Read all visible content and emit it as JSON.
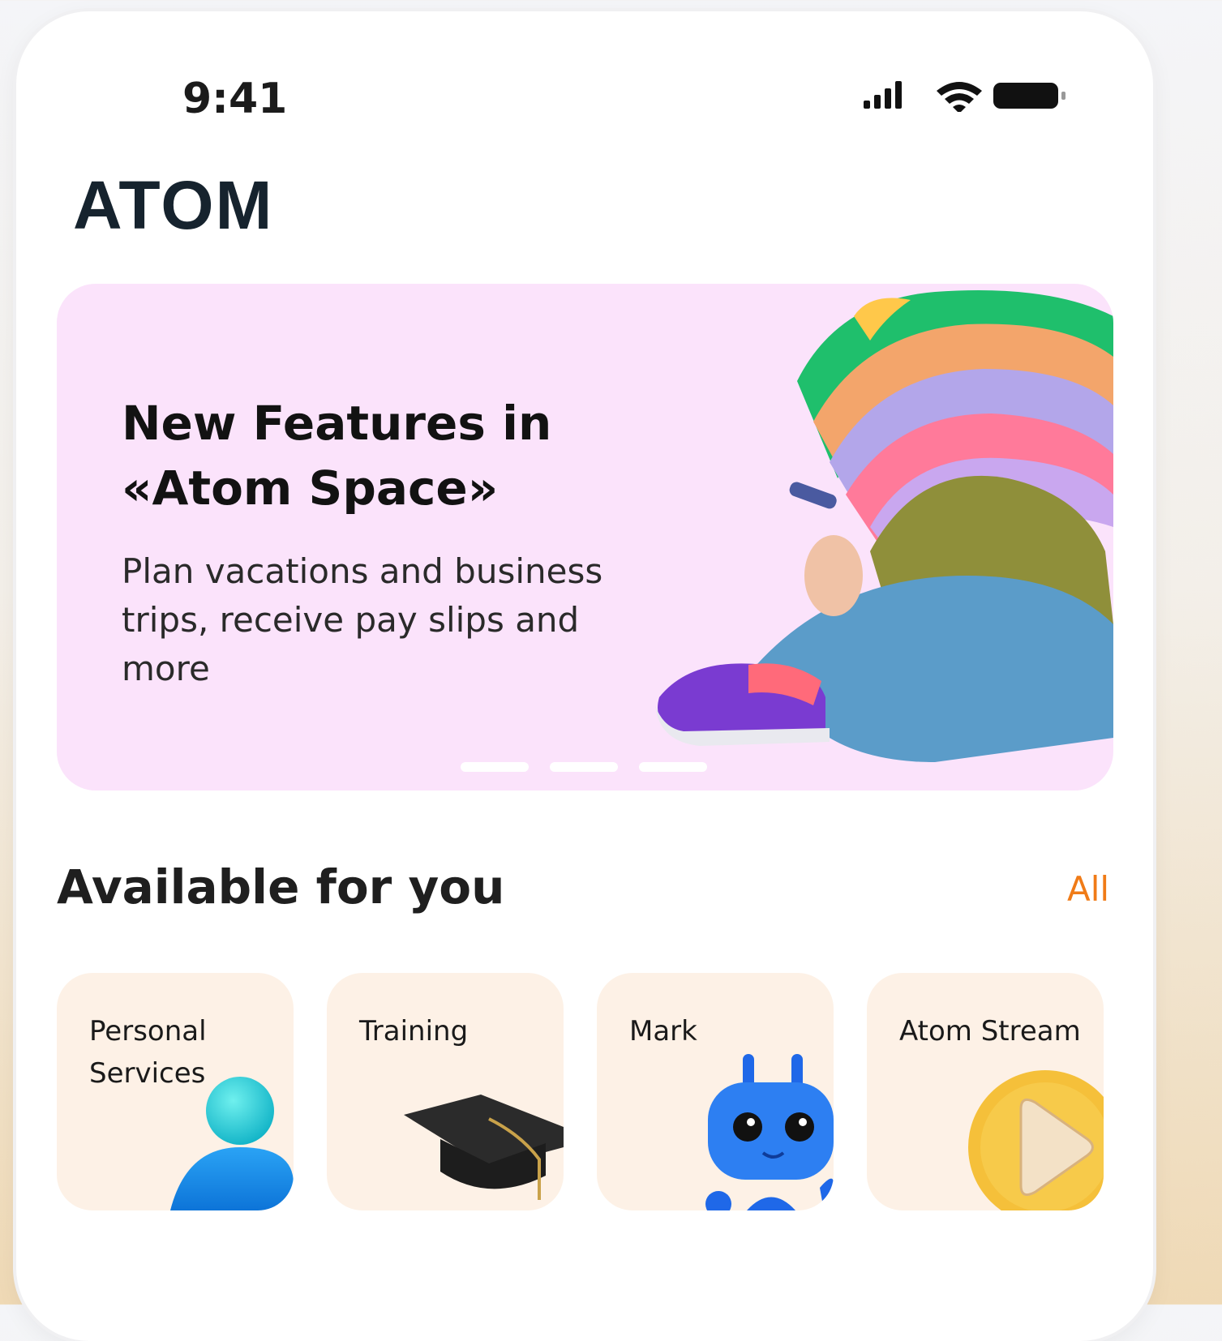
{
  "status_bar": {
    "time": "9:41"
  },
  "header": {
    "logo_text": "ATOM"
  },
  "banner": {
    "title": "New Features in\n«Atom Space»",
    "description": "Plan vacations and business trips, receive pay slips and more",
    "pagination": {
      "count": 3,
      "active": 0
    }
  },
  "section": {
    "title": "Available for you",
    "all_label": "All"
  },
  "services": [
    {
      "label": "Personal\nServices",
      "icon": "person-icon"
    },
    {
      "label": "Training",
      "icon": "graduation-cap-icon"
    },
    {
      "label": "Mark",
      "icon": "robot-icon"
    },
    {
      "label": "Atom Stream",
      "icon": "play-icon"
    }
  ],
  "colors": {
    "accent": "#f07b17",
    "banner_bg": "#fbe3fb",
    "card_bg": "#fdf1e6"
  }
}
